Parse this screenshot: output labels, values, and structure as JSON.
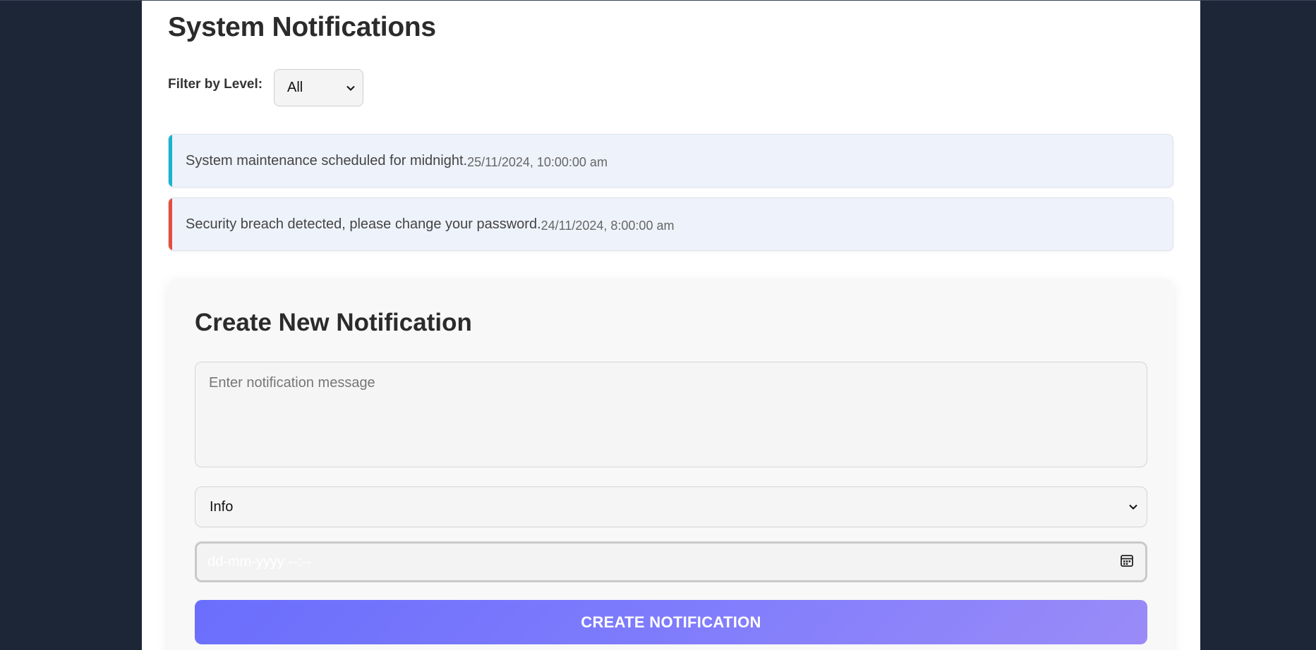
{
  "page": {
    "title": "System Notifications"
  },
  "filter": {
    "label": "Filter by Level:",
    "selected": "All"
  },
  "notifications": [
    {
      "message": "System maintenance scheduled for midnight.",
      "timestamp": "25/11/2024, 10:00:00 am",
      "level_color": "#17b4cf"
    },
    {
      "message": "Security breach detected, please change your password.",
      "timestamp": "24/11/2024, 8:00:00 am",
      "level_color": "#e74c3c"
    }
  ],
  "form": {
    "title": "Create New Notification",
    "message_placeholder": "Enter notification message",
    "level_selected": "Info",
    "datetime_placeholder": "dd-mm-yyyy --:--",
    "submit_label": "CREATE NOTIFICATION"
  },
  "icons": {
    "filter_dropdown": "chevron-down-icon",
    "level_dropdown": "chevron-down-icon",
    "date_picker": "calendar-icon"
  },
  "colors": {
    "background": "#1c2636",
    "button_gradient_start": "#6a6efc",
    "button_gradient_end": "#9a8bf8"
  }
}
